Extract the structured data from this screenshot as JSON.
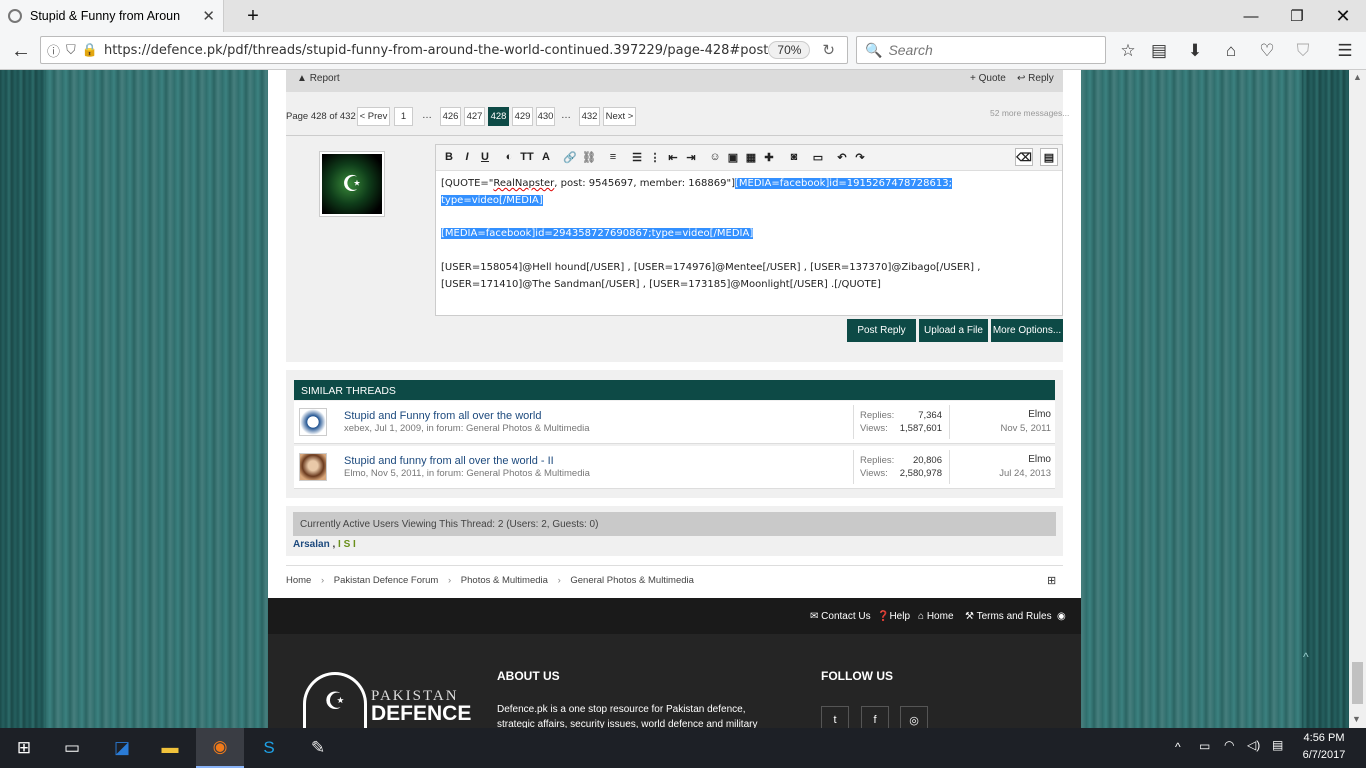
{
  "browser": {
    "tab_title": "Stupid & Funny from Aroun",
    "url": "https://defence.pk/pdf/threads/stupid-funny-from-around-the-world-continued.397229/page-428#post",
    "zoom": "70%",
    "search_placeholder": "Search"
  },
  "post_actions": {
    "report": "Report",
    "quote": "+ Quote",
    "reply": "Reply"
  },
  "pagination": {
    "label": "Page 428 of 432",
    "prev": "< Prev",
    "pages": [
      "1",
      "…",
      "426",
      "427",
      "428",
      "429",
      "430",
      "…",
      "432"
    ],
    "current": "428",
    "next": "Next >",
    "more": "52 more messages..."
  },
  "editor": {
    "line1_a": "[QUOTE=\"",
    "line1_b": "RealNapster",
    "line1_c": ", post: 9545697, member: 168869\"]",
    "line1_sel": "[MEDIA=facebook]id=1915267478728613;",
    "line2_sel": "type=video[/MEDIA]",
    "line3_sel": "[MEDIA=facebook]id=294358727690867;type=video[/MEDIA]",
    "line4": "[USER=158054]@Hell hound[/USER] , [USER=174976]@Mentee[/USER] , [USER=137370]@Zibago[/USER] ,",
    "line5": "[USER=171410]@The Sandman[/USER] , [USER=173185]@Moonlight[/USER]  .[/QUOTE]"
  },
  "buttons": {
    "post_reply": "Post Reply",
    "upload": "Upload a File",
    "more": "More Options..."
  },
  "similar": {
    "heading": "SIMILAR THREADS",
    "rows": [
      {
        "title": "Stupid and Funny from all over the world",
        "meta": "xebex, Jul 1, 2009, in forum: General Photos & Multimedia",
        "replies_label": "Replies:",
        "replies": "7,364",
        "views_label": "Views:",
        "views": "1,587,601",
        "last_user": "Elmo",
        "last_date": "Nov 5, 2011"
      },
      {
        "title": "Stupid and funny from all over the world - II",
        "meta": "Elmo, Nov 5, 2011, in forum: General Photos & Multimedia",
        "replies_label": "Replies:",
        "replies": "20,806",
        "views_label": "Views:",
        "views": "2,580,978",
        "last_user": "Elmo",
        "last_date": "Jul 24, 2013"
      }
    ]
  },
  "active_users": {
    "label": "Currently Active Users Viewing This Thread: 2 (Users: 2, Guests: 0)",
    "user1": "Arsalan",
    "sep": ",",
    "user2": "I S I"
  },
  "breadcrumb": [
    "Home",
    "Pakistan Defence Forum",
    "Photos & Multimedia",
    "General Photos & Multimedia"
  ],
  "footer": {
    "links": [
      "Contact Us",
      "Help",
      "Home",
      "Terms and Rules"
    ],
    "about_heading": "ABOUT US",
    "about_text1": "Defence.pk is a one stop resource for Pakistan defence,",
    "about_text2": "strategic affairs, security issues, world defence and military",
    "follow_heading": "FOLLOW US",
    "logo_top": "PAKISTAN",
    "logo_bottom": "DEFENCE"
  },
  "taskbar": {
    "time": "4:56 PM",
    "date": "6/7/2017"
  }
}
